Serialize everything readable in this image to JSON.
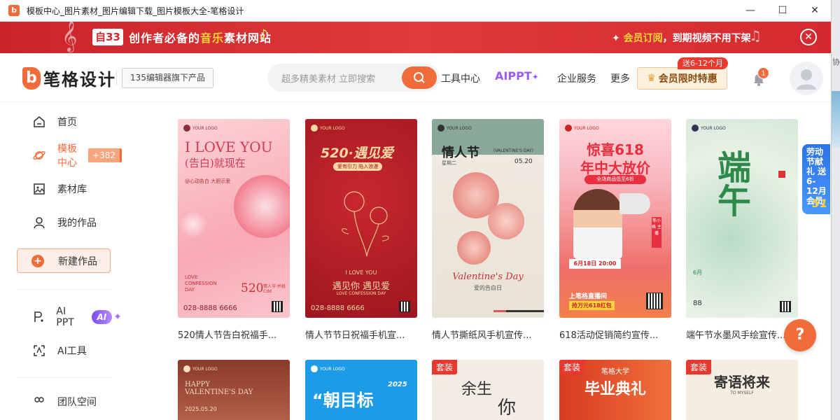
{
  "window": {
    "title": "模板中心_图片素材_图片编辑下载_图片模板大全-笔格设计",
    "controls": [
      "—",
      "☐",
      "✕"
    ]
  },
  "banner": {
    "logo": "自33",
    "slogan_pre": "创作者必备的",
    "slogan_hl": "音乐",
    "slogan_post": "素材网站",
    "vip_pre": "会员订阅",
    "vip_post": "，到期视频不用下架"
  },
  "header": {
    "brand": "笔格设计",
    "tagline": "135编辑器旗下产品",
    "search_placeholder": "超多精美素材 立即搜索",
    "nav": [
      "工具中心",
      "AIPPT",
      "企业服务",
      "更多"
    ],
    "vip_button": "会员限时特惠",
    "vip_badge": "送6-12个月",
    "notif_count": "1"
  },
  "sidebar": {
    "items": [
      {
        "label": "首页",
        "icon": "home-icon"
      },
      {
        "label": "模板中心",
        "icon": "planet-icon",
        "count": "+382张"
      },
      {
        "label": "素材库",
        "icon": "image-icon"
      },
      {
        "label": "我的作品",
        "icon": "user-icon"
      }
    ],
    "new_button": "新建作品",
    "ai_ppt": "AI PPT",
    "ai_badge": "AI",
    "ai_tools": "AI工具",
    "partial_item": "团队空间"
  },
  "cards": [
    {
      "caption": "520情人节告白祝福手...",
      "title": "I LOVE YOU",
      "subtitle": "(告白)就现在",
      "tag": "@心动告白 大胆示爱",
      "foot1": "LOVE CONFESSION DAY",
      "foot2": "520",
      "foot3": "情人节·并肩Cdd",
      "phone": "028-8888 6666",
      "logo": "YOUR LOGO"
    },
    {
      "caption": "情人节节日祝福手机宣...",
      "title": "520·遇见爱",
      "subtitle": "爱有引力 陷入浪漫",
      "foot1": "I LOVE YOU",
      "foot2": "遇见你 遇见爱",
      "foot3": "LOVE CONFESSION DAY",
      "phone": "028-8888 6666",
      "logo": "YOUR LOGO"
    },
    {
      "caption": "情人节撕纸风手机宣传...",
      "title": "情人节",
      "subtitle": "(VALENTINE'S DAY)",
      "weekday": "星期二",
      "date": "05.20",
      "foot1": "Valentine's Day",
      "foot2": "爱的告白日",
      "logo": "YOUR LOGO"
    },
    {
      "caption": "618活动促销简约宣传...",
      "title": "惊喜618",
      "subtitle": "年中大放价",
      "pill": "全场商品低至6折",
      "date": "6月18日 20:00",
      "foot1": "上笔格直播间",
      "foot2": "抢万元618红包",
      "side": "笔小格 主播",
      "logo": "YOUR LOGO"
    },
    {
      "caption": "端午节水墨风手绘宣传...",
      "title": "端午",
      "date": "6月",
      "num": "88",
      "logo": "YOUR LOGO"
    }
  ],
  "row2": [
    {
      "tag": "",
      "text1": "HAPPY VALENTINE'S DAY",
      "text2": "2025.05.20",
      "logo": "YOUR LOGO"
    },
    {
      "tag": "",
      "text1": "“朝目标",
      "text2": "2025",
      "logo": "YOUR LOGO"
    },
    {
      "tag": "套装",
      "text1": "余生",
      "text2": "你"
    },
    {
      "tag": "套装",
      "text1": "笔格大学",
      "text2": "毕业典礼"
    },
    {
      "tag": "套装",
      "text1": "寄语将来",
      "text2": "TO MYSELF"
    }
  ],
  "float": {
    "text": "劳动节献礼 送6-12月会员",
    "num": "51"
  },
  "help": "?"
}
